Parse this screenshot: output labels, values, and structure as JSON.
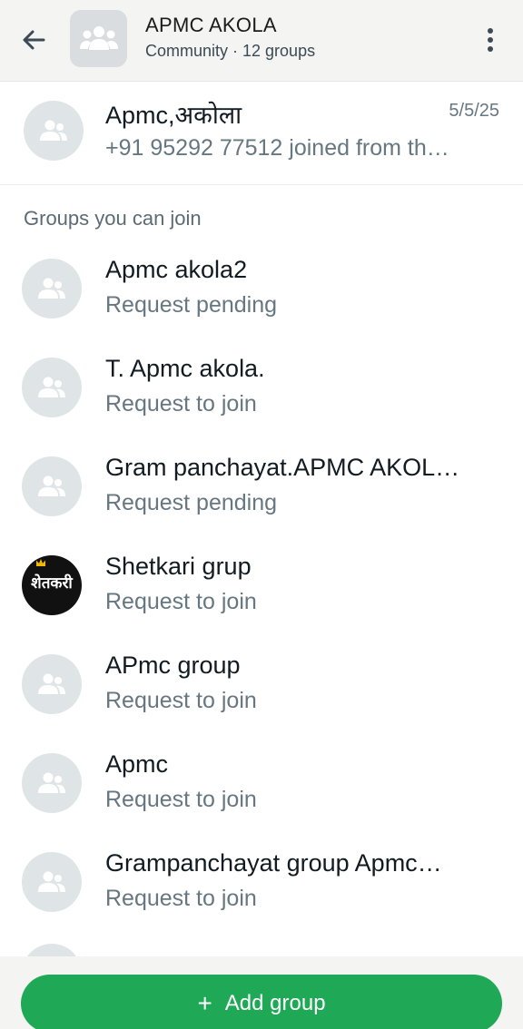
{
  "header": {
    "title": "APMC AKOLA",
    "subtitle": "Community · 12 groups"
  },
  "announcement": {
    "title": "Apmc,अकोला",
    "date": "5/5/25",
    "preview": "+91 95292 77512 joined from th…"
  },
  "section_label": "Groups you can join",
  "groups": [
    {
      "name": "Apmc akola2",
      "status": "Request pending",
      "avatar": "people-icon"
    },
    {
      "name": "T.  Apmc akola.",
      "status": "Request to join",
      "avatar": "people-icon"
    },
    {
      "name": "Gram panchayat.APMC AKOL…",
      "status": "Request pending",
      "avatar": "people-icon"
    },
    {
      "name": "Shetkari grup",
      "status": "Request to join",
      "avatar": "image",
      "avatar_text": "शेतकरी"
    },
    {
      "name": "APmc group",
      "status": "Request to join",
      "avatar": "people-icon"
    },
    {
      "name": "Apmc",
      "status": "Request to join",
      "avatar": "people-icon"
    },
    {
      "name": "Grampanchayat group Apmc…",
      "status": "Request to join",
      "avatar": "people-icon"
    }
  ],
  "add_group_label": "Add group",
  "colors": {
    "accent_green": "#1fa855",
    "header_bg": "#f4f4f2",
    "avatar_bg": "#dfe5e7",
    "secondary_text": "#667781"
  }
}
